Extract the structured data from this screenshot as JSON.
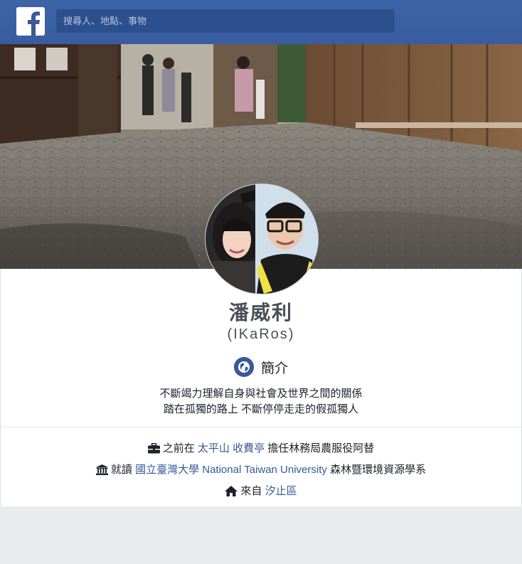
{
  "header": {
    "logo": "facebook-logo",
    "search_placeholder": "搜尋人、地點、事物"
  },
  "profile": {
    "name": "潘威利",
    "alias": "(IKaRos)",
    "intro_title": "簡介",
    "bio_line1": "不斷竭力理解自身與社會及世界之間的關係",
    "bio_line2": "踏在孤獨的路上 不斷停停走走的假孤獨人"
  },
  "info": {
    "work": {
      "icon": "briefcase-icon",
      "prefix": "之前在",
      "place": "太平山 收費亭",
      "suffix": "擔任林務局農服役阿替"
    },
    "education": {
      "icon": "school-icon",
      "prefix": "就讀",
      "school": "國立臺灣大學 National Taiwan University",
      "suffix": "森林暨環境資源學系"
    },
    "hometown": {
      "icon": "home-icon",
      "prefix": "來自",
      "place": "汐止區"
    }
  },
  "colors": {
    "brand": "#3b5998",
    "link": "#365899",
    "text": "#1d2129",
    "name": "#4b4f56"
  }
}
